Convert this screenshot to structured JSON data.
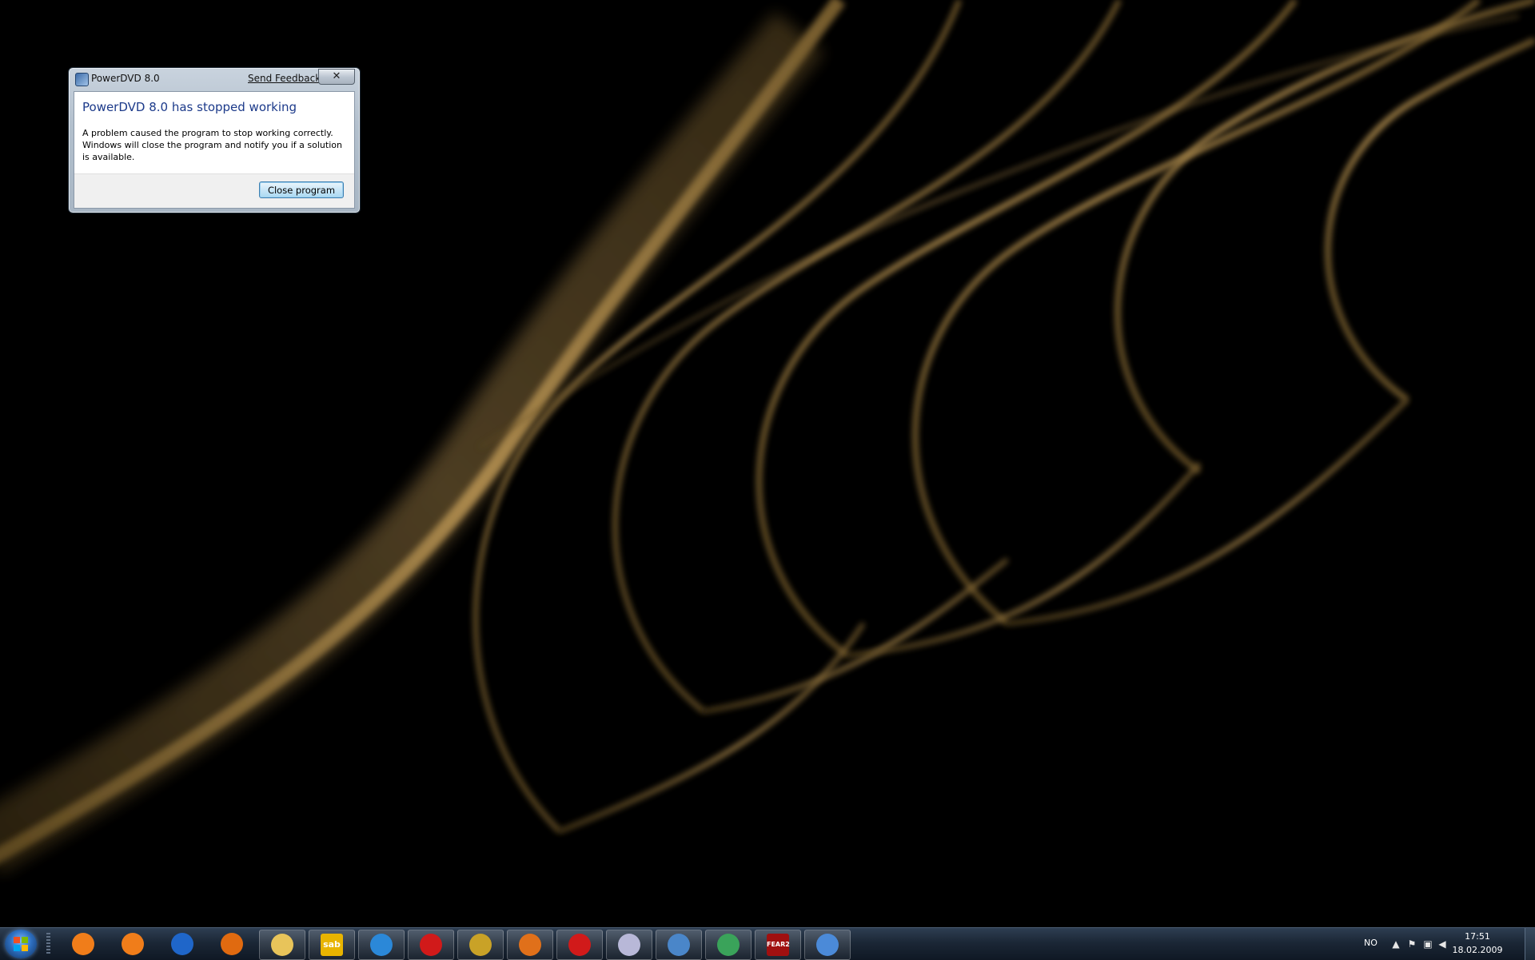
{
  "dialog": {
    "title": "PowerDVD 8.0",
    "send_feedback": "Send Feedback",
    "close_glyph": "✕",
    "heading": "PowerDVD 8.0 has stopped working",
    "message": "A problem caused the program to stop working correctly. Windows will close the program and notify you if a solution is available.",
    "close_button": "Close program"
  },
  "taskbar": {
    "items": [
      {
        "icon": "media-center-icon",
        "color": "#f07d1a"
      },
      {
        "icon": "media-player-icon",
        "color": "#f07d1a"
      },
      {
        "icon": "network-center-icon",
        "color": "#1f66c9"
      },
      {
        "icon": "info-shield-icon",
        "color": "#e06a10"
      },
      {
        "icon": "folder-icon",
        "color": "#e8c45a"
      },
      {
        "icon": "sabnzbd-icon",
        "label": "sab",
        "color": "#e8b400"
      },
      {
        "icon": "internet-explorer-icon",
        "color": "#2b88d8"
      },
      {
        "icon": "opera-icon",
        "color": "#d11a1a"
      },
      {
        "icon": "audio-app-icon",
        "color": "#c9a227"
      },
      {
        "icon": "firefox-fox-icon",
        "color": "#e0701a"
      },
      {
        "icon": "x-app-icon",
        "color": "#d11a1a"
      },
      {
        "icon": "dvd-disc-icon",
        "color": "#b8b8d8"
      },
      {
        "icon": "monitor-app-icon",
        "color": "#4a86c9"
      },
      {
        "icon": "messenger-icon",
        "color": "#3aa35a"
      },
      {
        "icon": "fear2-game-icon",
        "label": "FEAR2",
        "color": "#a01010"
      },
      {
        "icon": "checklist-app-icon",
        "color": "#4b8ad8"
      }
    ],
    "tray": {
      "language": "NO",
      "time": "17:51",
      "date": "18.02.2009"
    }
  }
}
